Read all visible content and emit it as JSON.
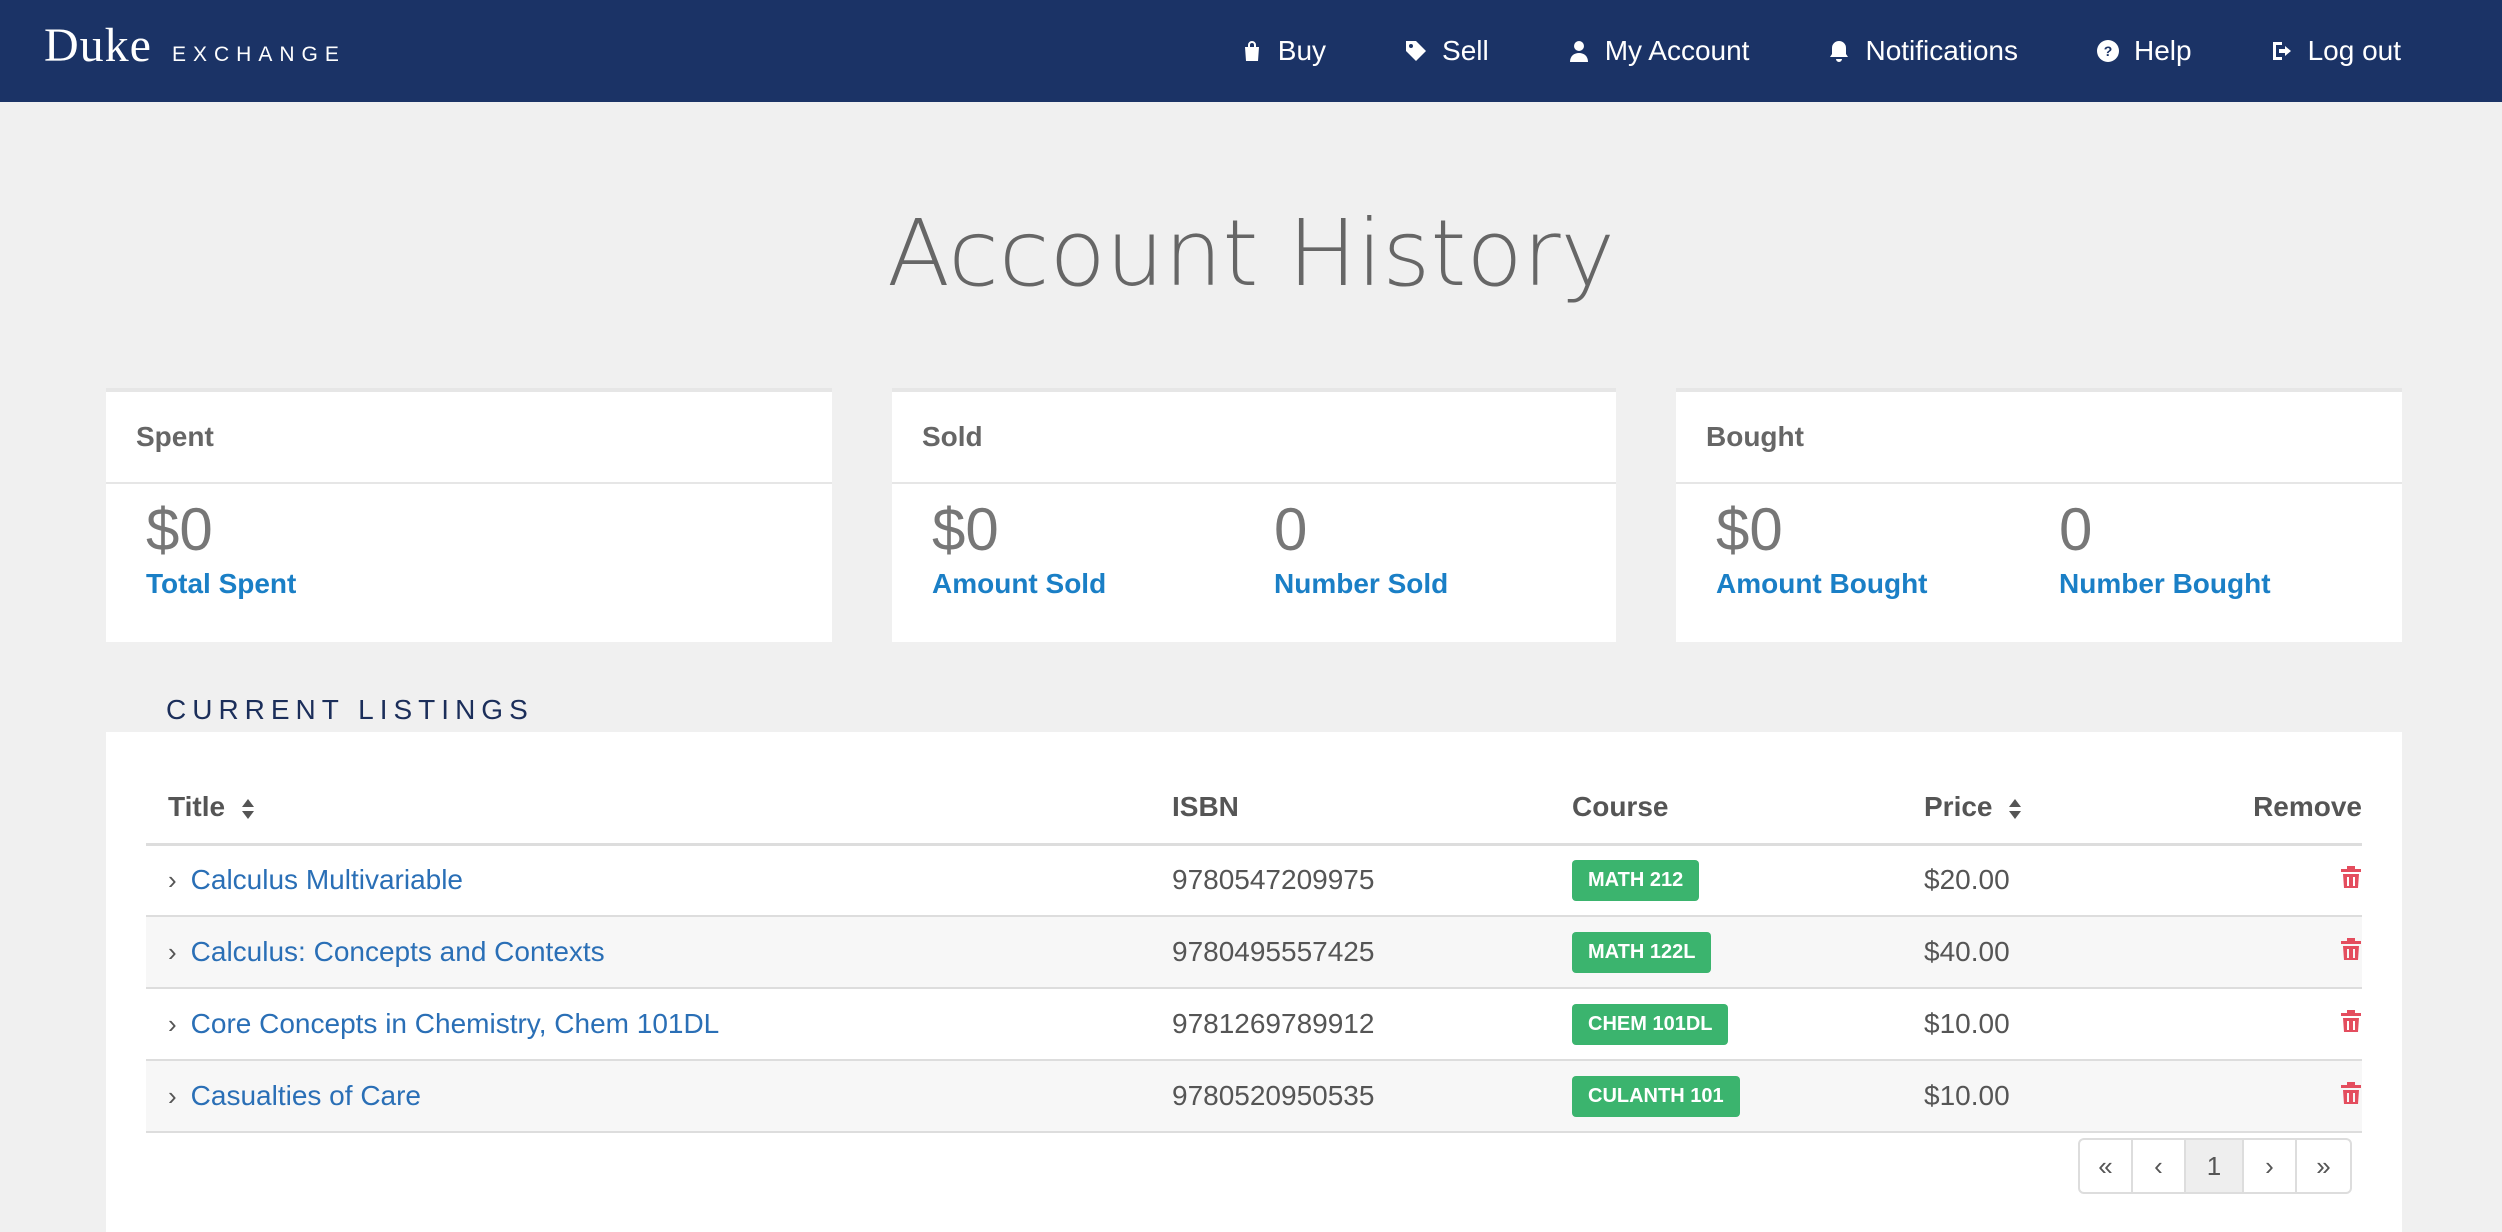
{
  "brand": {
    "primary": "Duke",
    "secondary": "EXCHANGE"
  },
  "nav": [
    {
      "label": "Buy",
      "icon": "shopping-bag-icon"
    },
    {
      "label": "Sell",
      "icon": "tag-icon"
    },
    {
      "label": "My Account",
      "icon": "user-icon"
    },
    {
      "label": "Notifications",
      "icon": "bell-icon"
    },
    {
      "label": "Help",
      "icon": "help-circle-icon"
    },
    {
      "label": "Log out",
      "icon": "logout-icon"
    }
  ],
  "page_title": "Account History",
  "cards": {
    "spent": {
      "header": "Spent",
      "stats": [
        {
          "value": "$0",
          "label": "Total Spent"
        }
      ]
    },
    "sold": {
      "header": "Sold",
      "stats": [
        {
          "value": "$0",
          "label": "Amount Sold"
        },
        {
          "value": "0",
          "label": "Number Sold"
        }
      ]
    },
    "bought": {
      "header": "Bought",
      "stats": [
        {
          "value": "$0",
          "label": "Amount Bought"
        },
        {
          "value": "0",
          "label": "Number Bought"
        }
      ]
    }
  },
  "listings": {
    "section_title": "CURRENT LISTINGS",
    "columns": {
      "title": "Title",
      "isbn": "ISBN",
      "course": "Course",
      "price": "Price",
      "remove": "Remove"
    },
    "rows": [
      {
        "title": "Calculus Multivariable",
        "isbn": "9780547209975",
        "course": "MATH 212",
        "price": "$20.00"
      },
      {
        "title": "Calculus: Concepts and Contexts",
        "isbn": "9780495557425",
        "course": "MATH 122L",
        "price": "$40.00"
      },
      {
        "title": "Core Concepts in Chemistry, Chem 101DL",
        "isbn": "9781269789912",
        "course": "CHEM 101DL",
        "price": "$10.00"
      },
      {
        "title": "Casualties of Care",
        "isbn": "9780520950535",
        "course": "CULANTH 101",
        "price": "$10.00"
      }
    ]
  },
  "pagination": {
    "first": "«",
    "prev": "‹",
    "current": "1",
    "next": "›",
    "last": "»"
  },
  "colors": {
    "navbar": "#1b3366",
    "link": "#1a7fc6",
    "badge": "#3bb46e",
    "trash": "#e44d5e"
  }
}
